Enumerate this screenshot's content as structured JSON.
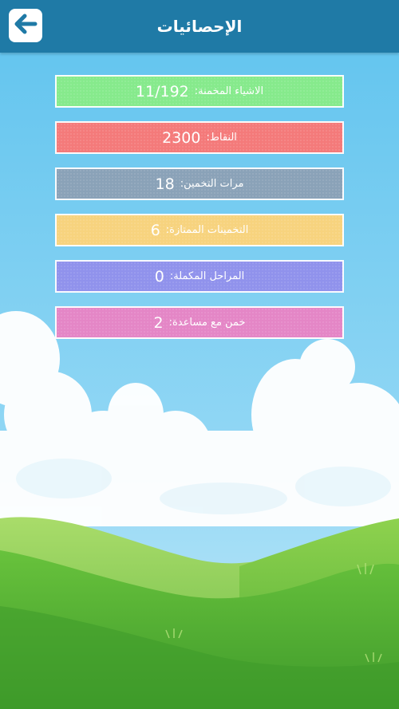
{
  "header": {
    "title": "الإحصائيات",
    "back_icon": "arrow-left-icon"
  },
  "stats": [
    {
      "label": "الاشياء المخمنة:",
      "value": "11/192",
      "color": "#86ea8c"
    },
    {
      "label": "النقاط:",
      "value": "2300",
      "color": "#f47a7a"
    },
    {
      "label": "مرات التخمين:",
      "value": "18",
      "color": "#8aa2b8"
    },
    {
      "label": "التخمينات الممتازة:",
      "value": "6",
      "color": "#f7d37e"
    },
    {
      "label": "المراحل المكملة:",
      "value": "0",
      "color": "#9092ec"
    },
    {
      "label": "خمن مع مساعدة:",
      "value": "2",
      "color": "#e486c6"
    }
  ],
  "colors": {
    "header": "#1f7aa6",
    "sky": "#5cc0ec",
    "grass": "#55b83b"
  }
}
